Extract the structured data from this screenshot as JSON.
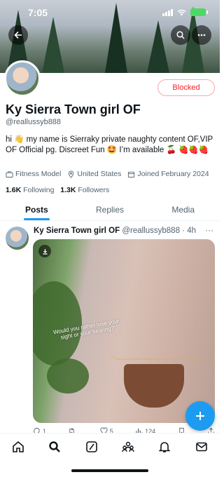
{
  "status_bar": {
    "time": "7:05"
  },
  "header": {
    "back_icon": "arrow-left-icon",
    "search_icon": "search-icon",
    "more_icon": "more-horizontal-icon"
  },
  "profile": {
    "blocked_label": "Blocked",
    "display_name": "Ky Sierra Town girl OF",
    "handle": "@reallussyb888",
    "bio": "hi 👋 my name is Sierraky private naughty content OF,VIP OF Official pg. Discreet Fun 🤩 I’m available 🍒 🍓🍓🍓",
    "category": "Fitness Model",
    "location": "United States",
    "joined": "Joined February 2024",
    "following_count": "1.6K",
    "following_label": "Following",
    "followers_count": "1.3K",
    "followers_label": "Followers"
  },
  "tabs": [
    {
      "label": "Posts",
      "active": true
    },
    {
      "label": "Replies",
      "active": false
    },
    {
      "label": "Media",
      "active": false
    }
  ],
  "tweet": {
    "name": "Ky Sierra Town girl OF",
    "handle": "@reallussyb888",
    "time": "· 4h",
    "more": "···",
    "media_text": "Would you rather lose your sight or your hearing?",
    "replies": "1",
    "retweets": "",
    "likes": "5",
    "views": "124"
  },
  "colors": {
    "accent": "#1d9bf0",
    "blocked": "#f4212e",
    "secondary_text": "#536471"
  }
}
